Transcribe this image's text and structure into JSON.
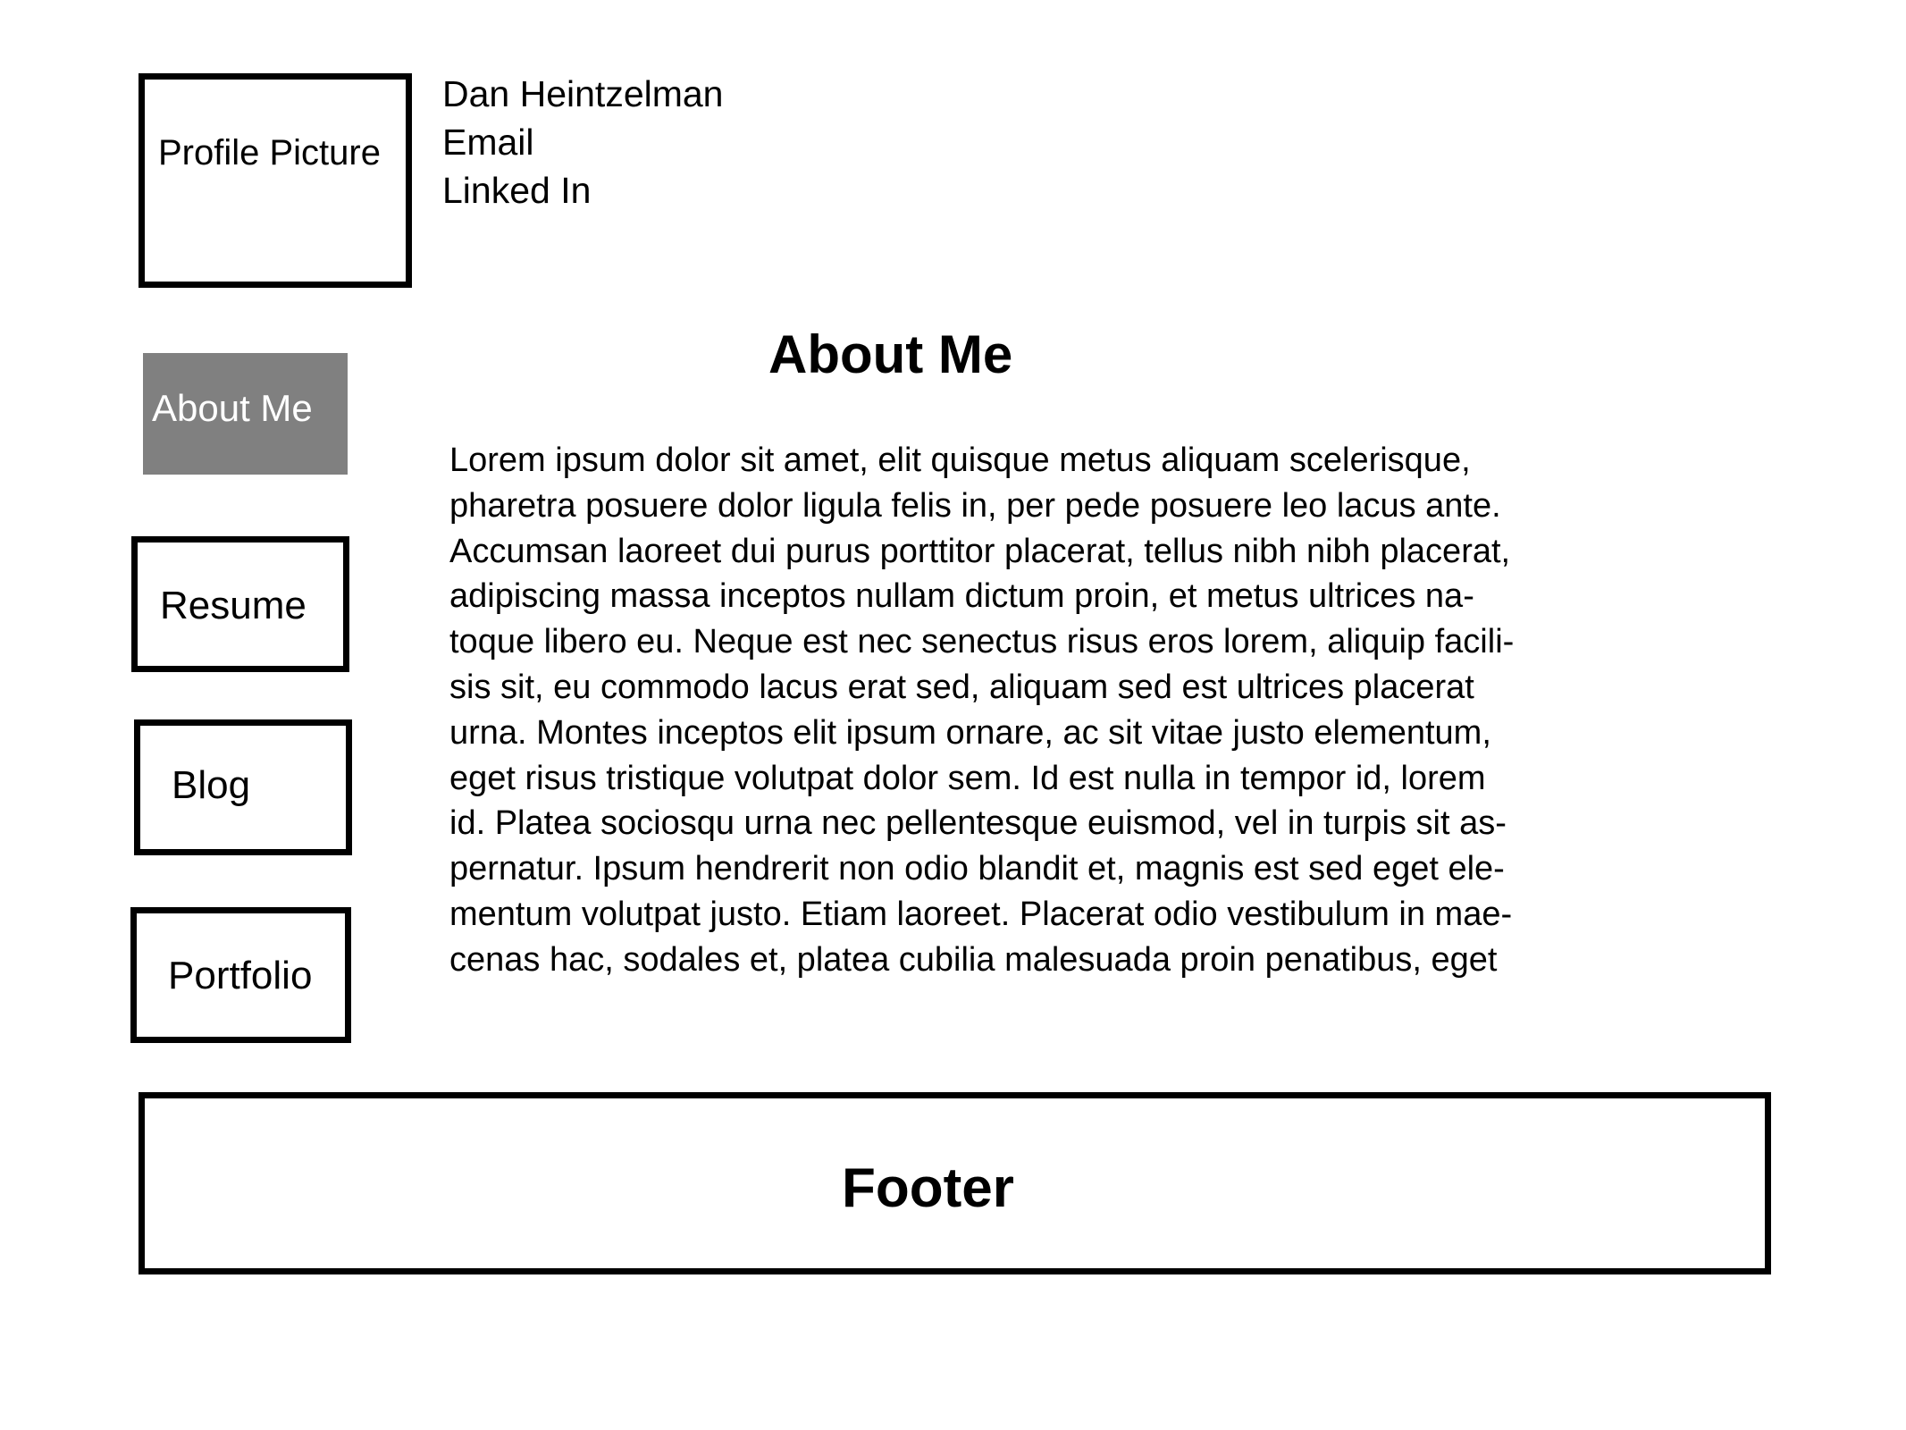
{
  "header": {
    "profile_picture_label": "Profile Picture",
    "name": "Dan Heintzelman",
    "email": "Email",
    "linkedin": "Linked In"
  },
  "nav": {
    "about": "About Me",
    "resume": "Resume",
    "blog": "Blog",
    "portfolio": "Portfolio",
    "active_color": "#808080"
  },
  "main": {
    "title": "About Me",
    "lines": [
      "Lorem ipsum dolor sit amet, elit quisque metus aliquam scelerisque,",
      "pharetra posuere dolor ligula felis in, per pede posuere leo lacus ante.",
      "Accumsan laoreet dui purus porttitor placerat, tellus nibh nibh placerat,",
      "adipiscing massa inceptos nullam dictum proin, et metus ultrices na-",
      "toque libero eu. Neque est nec senectus risus eros lorem, aliquip facili-",
      "sis sit, eu commodo lacus erat sed, aliquam sed est ultrices placerat",
      "urna. Montes inceptos elit ipsum ornare, ac sit vitae justo elementum,",
      "eget risus tristique volutpat dolor sem. Id est nulla in tempor id, lorem",
      "id. Platea sociosqu urna nec pellentesque euismod, vel in turpis sit as-",
      "pernatur. Ipsum hendrerit non odio blandit et, magnis est sed eget ele-",
      "mentum volutpat justo. Etiam laoreet. Placerat odio vestibulum in mae-",
      "cenas hac, sodales et, platea cubilia malesuada proin penatibus, eget"
    ]
  },
  "footer": {
    "label": "Footer"
  }
}
